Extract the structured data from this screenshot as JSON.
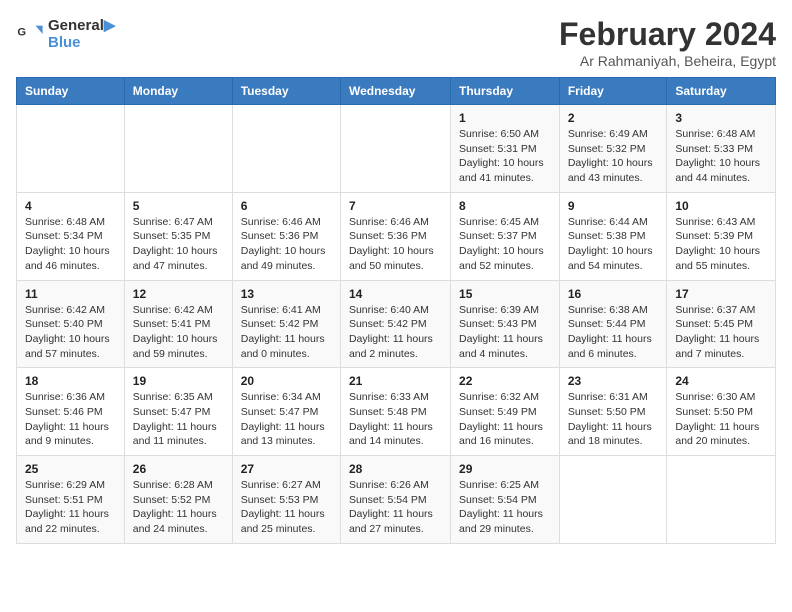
{
  "logo": {
    "line1": "General",
    "line2": "Blue"
  },
  "title": "February 2024",
  "subtitle": "Ar Rahmaniyah, Beheira, Egypt",
  "weekdays": [
    "Sunday",
    "Monday",
    "Tuesday",
    "Wednesday",
    "Thursday",
    "Friday",
    "Saturday"
  ],
  "weeks": [
    [
      {
        "day": "",
        "info": ""
      },
      {
        "day": "",
        "info": ""
      },
      {
        "day": "",
        "info": ""
      },
      {
        "day": "",
        "info": ""
      },
      {
        "day": "1",
        "info": "Sunrise: 6:50 AM\nSunset: 5:31 PM\nDaylight: 10 hours and 41 minutes."
      },
      {
        "day": "2",
        "info": "Sunrise: 6:49 AM\nSunset: 5:32 PM\nDaylight: 10 hours and 43 minutes."
      },
      {
        "day": "3",
        "info": "Sunrise: 6:48 AM\nSunset: 5:33 PM\nDaylight: 10 hours and 44 minutes."
      }
    ],
    [
      {
        "day": "4",
        "info": "Sunrise: 6:48 AM\nSunset: 5:34 PM\nDaylight: 10 hours and 46 minutes."
      },
      {
        "day": "5",
        "info": "Sunrise: 6:47 AM\nSunset: 5:35 PM\nDaylight: 10 hours and 47 minutes."
      },
      {
        "day": "6",
        "info": "Sunrise: 6:46 AM\nSunset: 5:36 PM\nDaylight: 10 hours and 49 minutes."
      },
      {
        "day": "7",
        "info": "Sunrise: 6:46 AM\nSunset: 5:36 PM\nDaylight: 10 hours and 50 minutes."
      },
      {
        "day": "8",
        "info": "Sunrise: 6:45 AM\nSunset: 5:37 PM\nDaylight: 10 hours and 52 minutes."
      },
      {
        "day": "9",
        "info": "Sunrise: 6:44 AM\nSunset: 5:38 PM\nDaylight: 10 hours and 54 minutes."
      },
      {
        "day": "10",
        "info": "Sunrise: 6:43 AM\nSunset: 5:39 PM\nDaylight: 10 hours and 55 minutes."
      }
    ],
    [
      {
        "day": "11",
        "info": "Sunrise: 6:42 AM\nSunset: 5:40 PM\nDaylight: 10 hours and 57 minutes."
      },
      {
        "day": "12",
        "info": "Sunrise: 6:42 AM\nSunset: 5:41 PM\nDaylight: 10 hours and 59 minutes."
      },
      {
        "day": "13",
        "info": "Sunrise: 6:41 AM\nSunset: 5:42 PM\nDaylight: 11 hours and 0 minutes."
      },
      {
        "day": "14",
        "info": "Sunrise: 6:40 AM\nSunset: 5:42 PM\nDaylight: 11 hours and 2 minutes."
      },
      {
        "day": "15",
        "info": "Sunrise: 6:39 AM\nSunset: 5:43 PM\nDaylight: 11 hours and 4 minutes."
      },
      {
        "day": "16",
        "info": "Sunrise: 6:38 AM\nSunset: 5:44 PM\nDaylight: 11 hours and 6 minutes."
      },
      {
        "day": "17",
        "info": "Sunrise: 6:37 AM\nSunset: 5:45 PM\nDaylight: 11 hours and 7 minutes."
      }
    ],
    [
      {
        "day": "18",
        "info": "Sunrise: 6:36 AM\nSunset: 5:46 PM\nDaylight: 11 hours and 9 minutes."
      },
      {
        "day": "19",
        "info": "Sunrise: 6:35 AM\nSunset: 5:47 PM\nDaylight: 11 hours and 11 minutes."
      },
      {
        "day": "20",
        "info": "Sunrise: 6:34 AM\nSunset: 5:47 PM\nDaylight: 11 hours and 13 minutes."
      },
      {
        "day": "21",
        "info": "Sunrise: 6:33 AM\nSunset: 5:48 PM\nDaylight: 11 hours and 14 minutes."
      },
      {
        "day": "22",
        "info": "Sunrise: 6:32 AM\nSunset: 5:49 PM\nDaylight: 11 hours and 16 minutes."
      },
      {
        "day": "23",
        "info": "Sunrise: 6:31 AM\nSunset: 5:50 PM\nDaylight: 11 hours and 18 minutes."
      },
      {
        "day": "24",
        "info": "Sunrise: 6:30 AM\nSunset: 5:50 PM\nDaylight: 11 hours and 20 minutes."
      }
    ],
    [
      {
        "day": "25",
        "info": "Sunrise: 6:29 AM\nSunset: 5:51 PM\nDaylight: 11 hours and 22 minutes."
      },
      {
        "day": "26",
        "info": "Sunrise: 6:28 AM\nSunset: 5:52 PM\nDaylight: 11 hours and 24 minutes."
      },
      {
        "day": "27",
        "info": "Sunrise: 6:27 AM\nSunset: 5:53 PM\nDaylight: 11 hours and 25 minutes."
      },
      {
        "day": "28",
        "info": "Sunrise: 6:26 AM\nSunset: 5:54 PM\nDaylight: 11 hours and 27 minutes."
      },
      {
        "day": "29",
        "info": "Sunrise: 6:25 AM\nSunset: 5:54 PM\nDaylight: 11 hours and 29 minutes."
      },
      {
        "day": "",
        "info": ""
      },
      {
        "day": "",
        "info": ""
      }
    ]
  ]
}
